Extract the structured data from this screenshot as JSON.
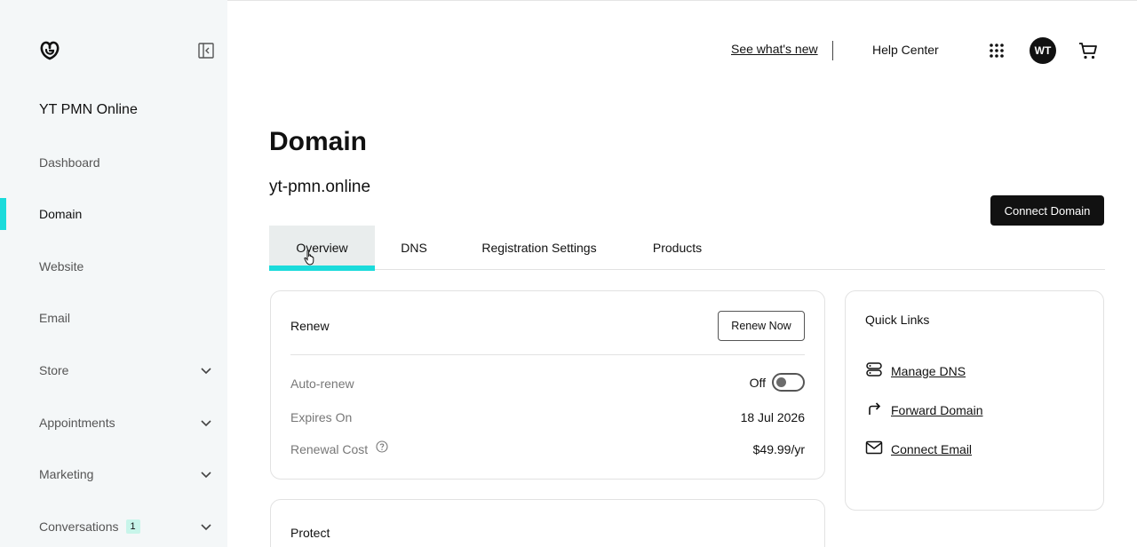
{
  "sidebar": {
    "site_name": "YT PMN Online",
    "items": [
      {
        "label": "Dashboard"
      },
      {
        "label": "Domain"
      },
      {
        "label": "Website"
      },
      {
        "label": "Email"
      },
      {
        "label": "Store"
      },
      {
        "label": "Appointments"
      },
      {
        "label": "Marketing"
      },
      {
        "label": "Conversations",
        "badge": "1"
      }
    ],
    "active_item": "Domain"
  },
  "header": {
    "whats_new": "See what's new",
    "help_center": "Help Center",
    "avatar_initials": "WT"
  },
  "main": {
    "title": "Domain",
    "domain_name": "yt-pmn.online",
    "connect_button": "Connect Domain",
    "tabs": [
      {
        "label": "Overview"
      },
      {
        "label": "DNS"
      },
      {
        "label": "Registration Settings"
      },
      {
        "label": "Products"
      }
    ],
    "active_tab": "Overview"
  },
  "renew_card": {
    "title": "Renew",
    "button": "Renew Now",
    "auto_renew_label": "Auto-renew",
    "auto_renew_value": "Off",
    "expires_label": "Expires On",
    "expires_value": "18 Jul 2026",
    "cost_label": "Renewal Cost",
    "cost_value": "$49.99/yr"
  },
  "protect_card": {
    "title": "Protect"
  },
  "quick_links": {
    "title": "Quick Links",
    "links": [
      {
        "label": "Manage DNS",
        "icon": "server-icon"
      },
      {
        "label": "Forward Domain",
        "icon": "forward-arrow-icon"
      },
      {
        "label": "Connect Email",
        "icon": "envelope-icon"
      }
    ]
  },
  "colors": {
    "accent": "#1bdbdb",
    "sidebar_bg": "#f4f7f8",
    "primary_button": "#111111"
  }
}
